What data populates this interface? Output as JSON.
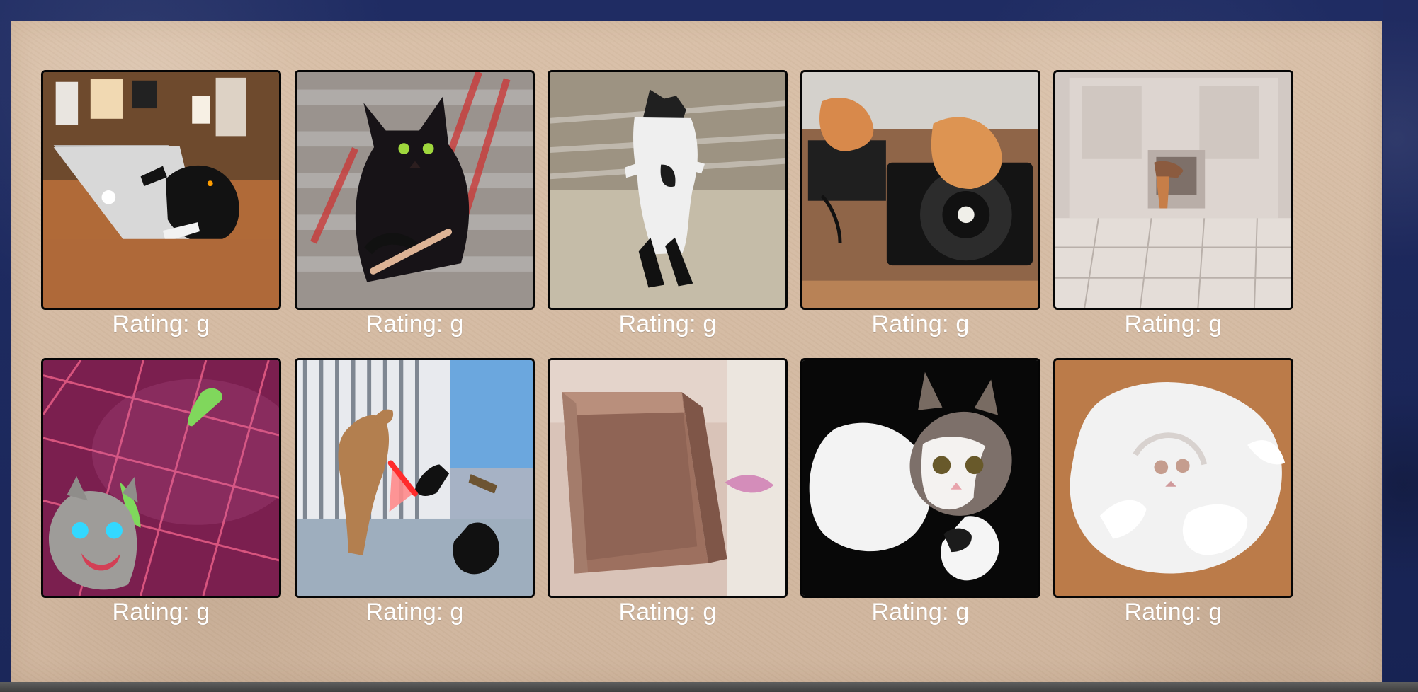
{
  "gallery": {
    "items": [
      {
        "rating": "Rating: g"
      },
      {
        "rating": "Rating: g"
      },
      {
        "rating": "Rating: g"
      },
      {
        "rating": "Rating: g"
      },
      {
        "rating": "Rating: g"
      },
      {
        "rating": "Rating: g"
      },
      {
        "rating": "Rating: g"
      },
      {
        "rating": "Rating: g"
      },
      {
        "rating": "Rating: g"
      },
      {
        "rating": "Rating: g"
      }
    ]
  }
}
